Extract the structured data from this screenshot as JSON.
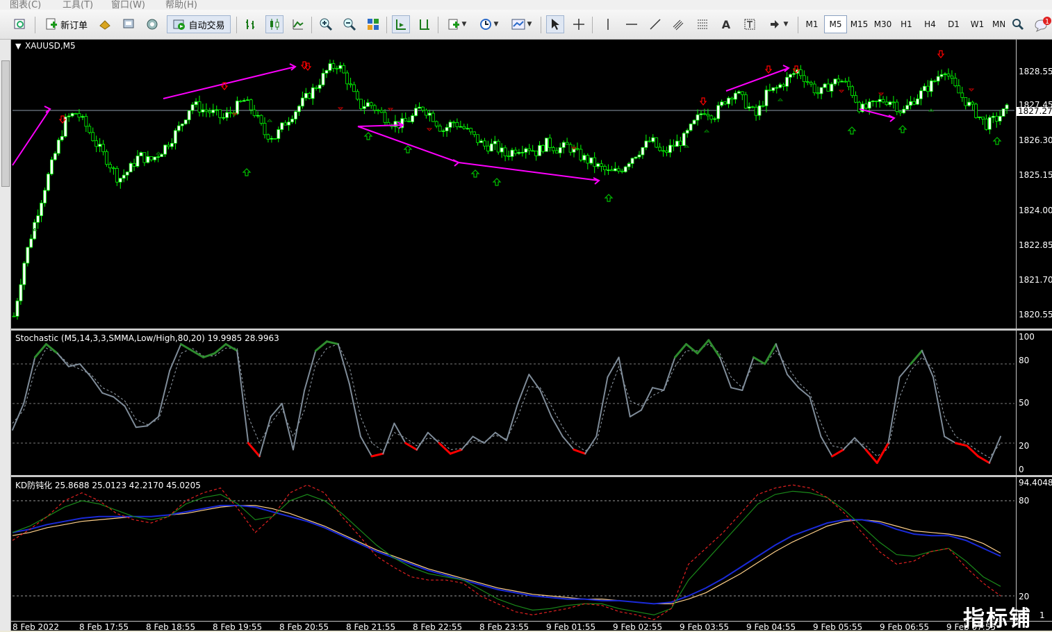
{
  "menu": {
    "chart": "图表(C)",
    "tools": "工具(T)",
    "window": "窗口(W)",
    "help": "帮助(H)"
  },
  "toolbar": {
    "new_order": "新订单",
    "auto_trade": "自动交易",
    "notify_count": "1"
  },
  "timeframes": [
    "M1",
    "M5",
    "M15",
    "M30",
    "H1",
    "H4",
    "D1",
    "W1",
    "MN"
  ],
  "timeframe_selected": "M5",
  "main": {
    "symbol_label": "XAUUSD,M5",
    "price_labels": [
      "1828.55",
      "1827.45",
      "1826.30",
      "1825.15",
      "1824.00",
      "1822.85",
      "1821.70",
      "1820.55"
    ],
    "current_price": "1827.27"
  },
  "stoch": {
    "label": "Stochastic (M5,14,3,3,SMMA,Low/High,80,20) 19.9985 28.9963",
    "levels": [
      "100",
      "80",
      "50",
      "20",
      "0"
    ]
  },
  "kd": {
    "label": "KD防钝化 25.8688 25.0123 42.2170 45.0205",
    "levels": [
      "94.4048",
      "80",
      "20",
      "1"
    ]
  },
  "time_labels": [
    "8 Feb 2022",
    "8 Feb 17:55",
    "8 Feb 18:55",
    "8 Feb 19:55",
    "8 Feb 20:55",
    "8 Feb 21:55",
    "8 Feb 22:55",
    "8 Feb 23:55",
    "9 Feb 01:55",
    "9 Feb 02:55",
    "9 Feb 03:55",
    "9 Feb 04:55",
    "9 Feb 05:55",
    "9 Feb 06:55",
    "9 Feb 07:55"
  ],
  "watermark": "指标铺",
  "colors": {
    "bull": "#ffffff",
    "bear": "#000000",
    "wick": "#00ff00",
    "trend": "#ff00ff",
    "up_arrow": "#00c000",
    "down_arrow": "#ff0000",
    "stoch_main": "#7f8c99",
    "stoch_ob": "#2e8b2e",
    "stoch_os": "#ff0000"
  },
  "price_path": [
    1820.5,
    1822.3,
    1823.6,
    1824.8,
    1825.9,
    1827.0,
    1827.2,
    1826.7,
    1826.1,
    1825.6,
    1825.0,
    1825.3,
    1825.8,
    1825.6,
    1825.9,
    1826.3,
    1826.8,
    1827.5,
    1827.3,
    1827.2,
    1827.0,
    1827.3,
    1827.6,
    1827.2,
    1826.5,
    1826.4,
    1826.9,
    1827.3,
    1827.7,
    1828.1,
    1828.6,
    1828.8,
    1828.2,
    1827.4,
    1827.5,
    1827.2,
    1826.9,
    1826.8,
    1827.0,
    1827.4,
    1827.1,
    1826.6,
    1826.9,
    1826.7,
    1826.4,
    1826.1,
    1826.1,
    1825.8,
    1826.0,
    1826.1,
    1825.9,
    1826.2,
    1826.0,
    1826.1,
    1825.8,
    1825.6,
    1825.4,
    1825.2,
    1825.3,
    1825.7,
    1826.0,
    1826.3,
    1825.8,
    1826.1,
    1826.3,
    1826.8,
    1827.3,
    1827.1,
    1827.6,
    1827.9,
    1827.5,
    1827.1,
    1827.8,
    1828.0,
    1828.3,
    1828.6,
    1828.2,
    1827.8,
    1828.1,
    1828.3,
    1828.0,
    1827.3,
    1827.4,
    1827.6,
    1827.6,
    1827.2,
    1827.6,
    1827.9,
    1828.2,
    1828.7,
    1828.0,
    1827.6,
    1827.2,
    1826.8,
    1827.0,
    1827.3
  ],
  "stoch_main": [
    30,
    50,
    85,
    95,
    88,
    78,
    80,
    70,
    58,
    55,
    48,
    32,
    33,
    40,
    75,
    95,
    90,
    85,
    88,
    95,
    90,
    20,
    10,
    40,
    50,
    15,
    60,
    90,
    97,
    95,
    65,
    25,
    10,
    12,
    35,
    20,
    15,
    28,
    20,
    12,
    15,
    25,
    20,
    28,
    22,
    50,
    72,
    60,
    40,
    25,
    15,
    12,
    25,
    70,
    85,
    40,
    45,
    62,
    60,
    85,
    95,
    88,
    98,
    85,
    62,
    60,
    85,
    80,
    95,
    72,
    62,
    55,
    25,
    10,
    15,
    24,
    15,
    5,
    20,
    70,
    80,
    90,
    70,
    25,
    20,
    18,
    10,
    5,
    25
  ],
  "stoch_signal": [
    35,
    45,
    75,
    92,
    88,
    80,
    76,
    72,
    62,
    58,
    52,
    38,
    34,
    38,
    60,
    88,
    92,
    86,
    86,
    92,
    92,
    40,
    20,
    35,
    46,
    25,
    45,
    80,
    92,
    95,
    78,
    40,
    20,
    14,
    28,
    24,
    18,
    24,
    22,
    15,
    16,
    22,
    21,
    26,
    23,
    40,
    63,
    62,
    48,
    32,
    20,
    14,
    20,
    55,
    78,
    52,
    48,
    56,
    60,
    78,
    90,
    90,
    95,
    88,
    70,
    62,
    80,
    80,
    90,
    78,
    66,
    58,
    35,
    18,
    16,
    22,
    18,
    10,
    16,
    55,
    75,
    85,
    76,
    40,
    25,
    20,
    14,
    9,
    20
  ],
  "kd_red": [
    55,
    62,
    70,
    80,
    85,
    80,
    72,
    68,
    66,
    70,
    80,
    85,
    88,
    75,
    60,
    70,
    85,
    90,
    85,
    70,
    58,
    45,
    38,
    32,
    30,
    30,
    28,
    20,
    15,
    10,
    8,
    10,
    12,
    15,
    14,
    10,
    8,
    5,
    12,
    40,
    50,
    60,
    72,
    84,
    88,
    90,
    88,
    82,
    72,
    60,
    48,
    40,
    42,
    48,
    50,
    38,
    28,
    20
  ],
  "kd_green": [
    60,
    64,
    70,
    76,
    80,
    78,
    74,
    70,
    68,
    70,
    78,
    82,
    84,
    78,
    68,
    70,
    80,
    84,
    80,
    72,
    62,
    52,
    44,
    38,
    34,
    32,
    30,
    24,
    18,
    14,
    11,
    12,
    14,
    15,
    15,
    12,
    10,
    8,
    12,
    30,
    42,
    54,
    66,
    78,
    84,
    86,
    85,
    82,
    74,
    64,
    54,
    46,
    45,
    48,
    50,
    42,
    32,
    26
  ],
  "kd_blue": [
    60,
    62,
    65,
    67,
    69,
    70,
    70,
    70,
    70,
    71,
    73,
    75,
    77,
    77,
    76,
    73,
    70,
    67,
    63,
    58,
    53,
    48,
    44,
    40,
    36,
    33,
    30,
    27,
    24,
    22,
    20,
    19,
    18,
    18,
    17,
    17,
    16,
    15,
    16,
    20,
    25,
    31,
    38,
    45,
    52,
    58,
    62,
    66,
    68,
    68,
    66,
    62,
    59,
    58,
    58,
    55,
    50,
    45
  ],
  "kd_orange": [
    58,
    60,
    63,
    65,
    67,
    68,
    69,
    70,
    70,
    71,
    72,
    74,
    76,
    77,
    77,
    75,
    72,
    68,
    64,
    59,
    54,
    49,
    45,
    41,
    37,
    34,
    31,
    28,
    25,
    23,
    21,
    20,
    19,
    18,
    18,
    17,
    16,
    15,
    15,
    18,
    22,
    28,
    34,
    41,
    48,
    54,
    59,
    64,
    67,
    68,
    67,
    64,
    61,
    60,
    59,
    57,
    53,
    47
  ]
}
